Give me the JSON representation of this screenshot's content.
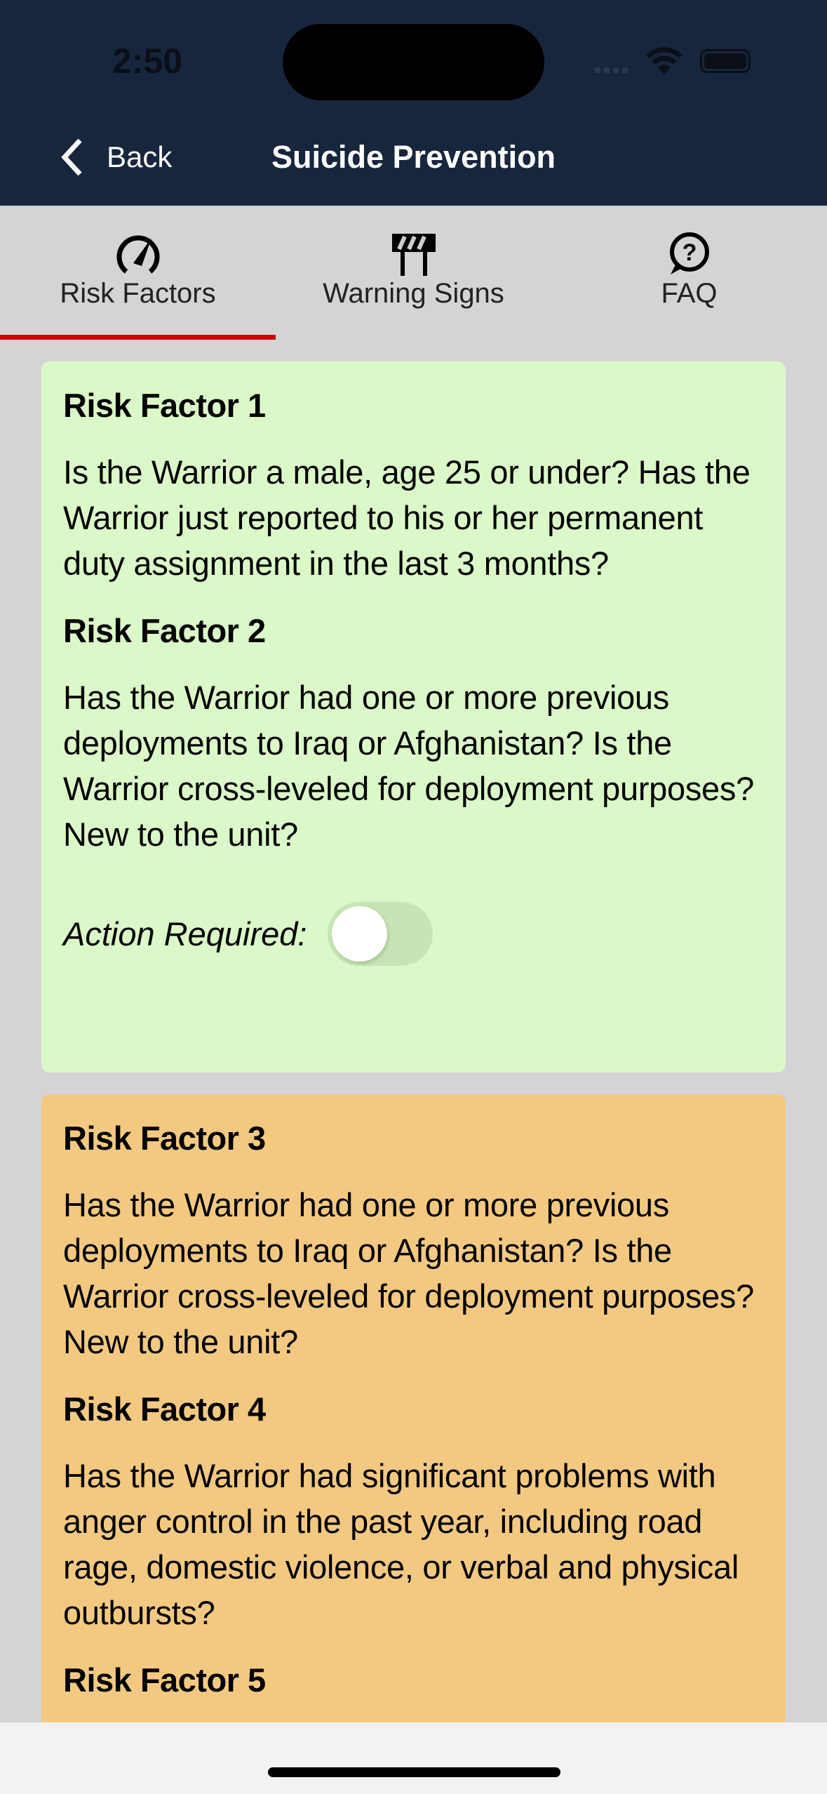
{
  "status_bar": {
    "time": "2:50"
  },
  "nav": {
    "back_label": "Back",
    "title": "Suicide Prevention"
  },
  "tabs": [
    {
      "label": "Risk Factors",
      "icon": "speedometer-icon",
      "active": true
    },
    {
      "label": "Warning Signs",
      "icon": "barrier-icon",
      "active": false
    },
    {
      "label": "FAQ",
      "icon": "question-bubble-icon",
      "active": false
    }
  ],
  "colors": {
    "nav": "#18263d",
    "accent": "#cc0000",
    "card_low": "#dbf9c8",
    "card_medium": "#f3c982"
  },
  "cards": [
    {
      "items": [
        {
          "title": "Risk Factor 1",
          "text": "Is the Warrior a male, age 25 or under? Has the Warrior just reported to his or her permanent duty assignment in the last 3 months?"
        },
        {
          "title": "Risk Factor 2",
          "text": "Has the Warrior had one or more previous deployments to Iraq or Afghanistan? Is the Warrior cross-leveled for deployment purposes? New to the unit?"
        }
      ],
      "action_label": "Action Required:",
      "action_on": false
    },
    {
      "items": [
        {
          "title": "Risk Factor 3",
          "text": "Has the Warrior had one or more previous deployments to Iraq or Afghanistan? Is the Warrior cross-leveled for deployment purposes? New to the unit?"
        },
        {
          "title": "Risk Factor 4",
          "text": "Has the Warrior had significant problems with anger control in the past year, including road rage, domestic violence, or verbal and physical outbursts?"
        },
        {
          "title": "Risk Factor 5"
        }
      ]
    }
  ]
}
